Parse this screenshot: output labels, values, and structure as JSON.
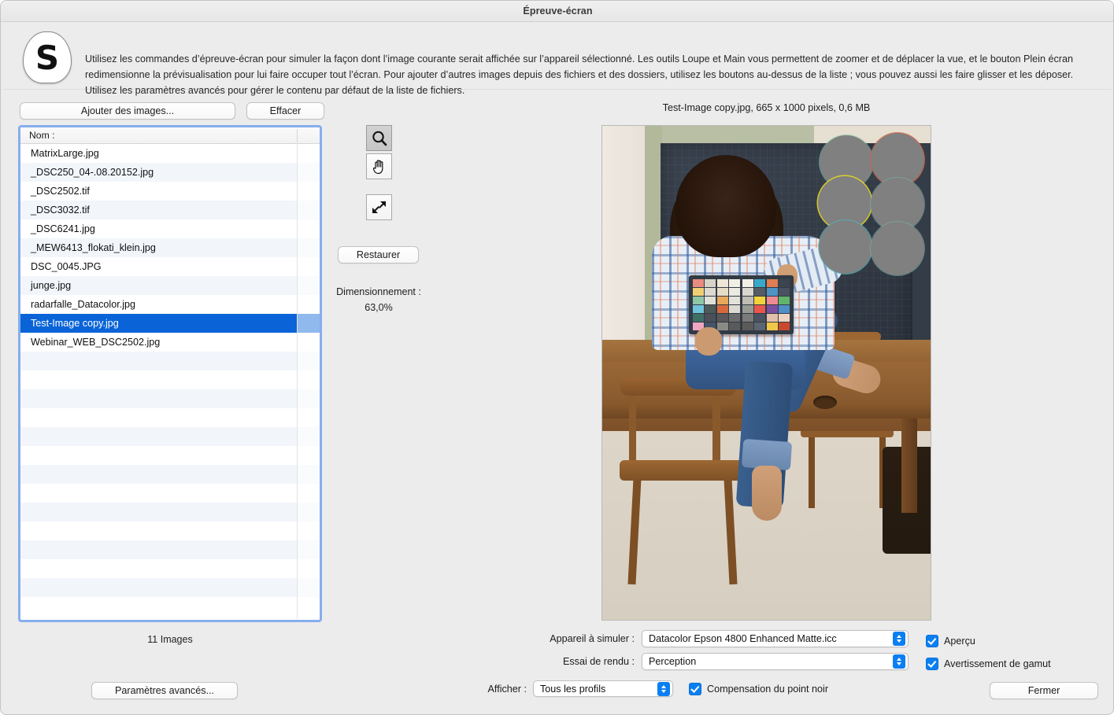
{
  "window": {
    "title": "Épreuve-écran"
  },
  "header": {
    "logo_letter": "S",
    "description": "Utilisez les commandes d’épreuve-écran pour simuler la façon dont l’image courante serait affichée sur l’appareil sélectionné. Les outils Loupe et Main vous permettent de zoomer et de déplacer la vue, et le bouton Plein écran redimensionne la prévisualisation pour lui faire occuper tout l’écran. Pour ajouter d’autres images depuis des fichiers et des dossiers, utilisez les boutons au-dessus de la liste ; vous pouvez aussi les faire glisser et les déposer. Utilisez les paramètres avancés pour gérer le contenu par défaut de la liste de fichiers."
  },
  "file_list": {
    "add_button": "Ajouter des images...",
    "clear_button": "Effacer",
    "column_header": "Nom :",
    "items": [
      "MatrixLarge.jpg",
      "_DSC250_04-.08.20152.jpg",
      "_DSC2502.tif",
      "_DSC3032.tif",
      "_DSC6241.jpg",
      "_MEW6413_flokati_klein.jpg",
      "DSC_0045.JPG",
      "junge.jpg",
      "radarfalle_Datacolor.jpg",
      "Test-Image copy.jpg",
      "Webinar_WEB_DSC2502.jpg"
    ],
    "selected_item": "Test-Image copy.jpg",
    "selected_index": 9,
    "count_label": "11 Images",
    "advanced_button": "Paramètres avancés..."
  },
  "tools": {
    "zoom_icon": "magnifier-icon",
    "hand_icon": "hand-icon",
    "fullscreen_icon": "fullscreen-arrows-icon",
    "restore_button": "Restaurer",
    "scaling_label": "Dimensionnement :",
    "scaling_value": "63,0%"
  },
  "preview": {
    "caption": "Test-Image copy.jpg, 665 x 1000 pixels, 0,6 MB",
    "gamut_warning_color": "#808080",
    "gamut_circle_count": 6
  },
  "settings": {
    "device_label": "Appareil à simuler :",
    "device_value": "Datacolor Epson 4800 Enhanced Matte.icc",
    "intent_label": "Essai de rendu :",
    "intent_value": "Perception",
    "show_label": "Afficher :",
    "show_value": "Tous les profils",
    "preview_checkbox": "Aperçu",
    "preview_checked": true,
    "gamut_checkbox": "Avertissement de gamut",
    "gamut_checked": true,
    "blackpoint_checkbox": "Compensation du point noir",
    "blackpoint_checked": true,
    "close_button": "Fermer"
  },
  "colors": {
    "accent": "#0a7ff2",
    "selection": "#0a64d8",
    "focus_ring": "#86aeee",
    "window_bg": "#ececec"
  },
  "checker_left": [
    "#e88c80",
    "#d8d3c8",
    "#efe6d6",
    "#f1eee6",
    "#f0cf74",
    "#dcdad0",
    "#e7dcc6",
    "#eceae2",
    "#8fc7a4",
    "#dfe0d8",
    "#e8a95a",
    "#e3e1d9",
    "#6fc4dc",
    "#4e5a57",
    "#d7693c",
    "#dcdad2",
    "#3f6f64",
    "#4a4f58",
    "#58585a",
    "#6b6b6c",
    "#f0a5c0",
    "#45546a",
    "#8b8b86",
    "#5a5a5c"
  ],
  "checker_right": [
    "#f2efe7",
    "#3aa9c9",
    "#e07d52",
    "#3c4450",
    "#d8d6cd",
    "#555c63",
    "#4f93c4",
    "#4a5262",
    "#bfbdb4",
    "#f2d33c",
    "#f08a92",
    "#63b36a",
    "#9a9a95",
    "#e8564c",
    "#7a4fa0",
    "#4e8fc6",
    "#7a7a78",
    "#4a5260",
    "#e2bfa8",
    "#edd3c2",
    "#5b5b5a",
    "#5a6472",
    "#f0c847",
    "#c9492f"
  ]
}
